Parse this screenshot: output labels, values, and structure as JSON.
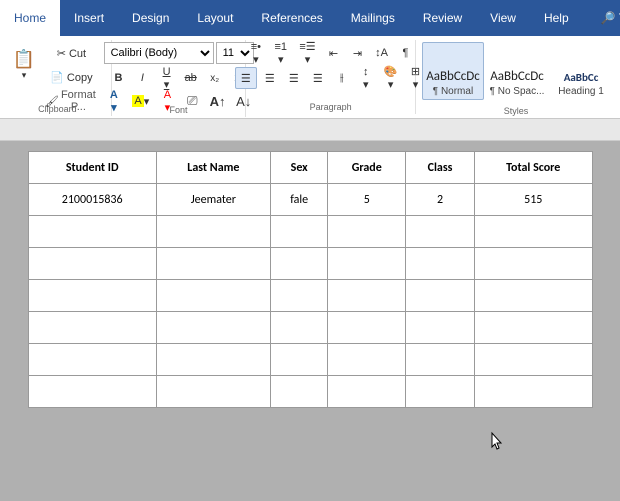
{
  "tabs": [
    {
      "label": "Home",
      "active": true
    },
    {
      "label": "Insert",
      "active": false
    },
    {
      "label": "Design",
      "active": false
    },
    {
      "label": "Layout",
      "active": false
    },
    {
      "label": "References",
      "active": false
    },
    {
      "label": "Mailings",
      "active": false
    },
    {
      "label": "Review",
      "active": false
    },
    {
      "label": "View",
      "active": false
    },
    {
      "label": "Help",
      "active": false
    },
    {
      "label": "Tell",
      "active": false
    }
  ],
  "font": {
    "name": "Calibri (Body)",
    "size": "11"
  },
  "groups": {
    "font_label": "Font",
    "paragraph_label": "Paragraph",
    "styles_label": "Styles"
  },
  "styles": [
    {
      "label": "¶ Normal",
      "preview": "AaBbCcDc"
    },
    {
      "label": "¶ No Spac...",
      "preview": "AaBbCcDc"
    },
    {
      "label": "Heading 1",
      "preview": "AaBbCc"
    }
  ],
  "table": {
    "headers": [
      "Student ID",
      "Last Name",
      "Sex",
      "Grade",
      "Class",
      "Total Score"
    ],
    "rows": [
      [
        "2100015836",
        "Jeemater",
        "fale",
        "5",
        "2",
        "515"
      ],
      [
        "",
        "",
        "",
        "",
        "",
        ""
      ],
      [
        "",
        "",
        "",
        "",
        "",
        ""
      ],
      [
        "",
        "",
        "",
        "",
        "",
        ""
      ],
      [
        "",
        "",
        "",
        "",
        "",
        ""
      ],
      [
        "",
        "",
        "",
        "",
        "",
        ""
      ],
      [
        "",
        "",
        "",
        "",
        "",
        ""
      ]
    ]
  }
}
